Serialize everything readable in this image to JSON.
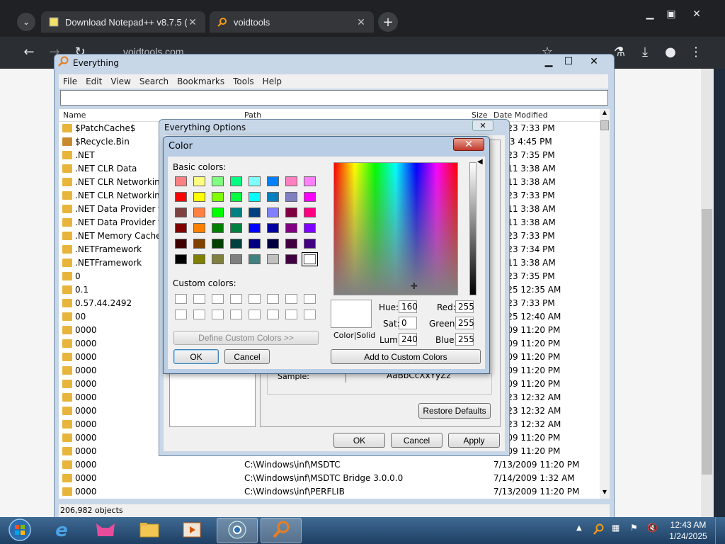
{
  "browser": {
    "tabs": [
      {
        "label": "Download Notepad++ v8.7.5 (",
        "active": false
      },
      {
        "label": "voidtools",
        "active": true
      }
    ],
    "address": "voidtools.com"
  },
  "everything": {
    "title": "Everything",
    "menu": [
      "File",
      "Edit",
      "View",
      "Search",
      "Bookmarks",
      "Tools",
      "Help"
    ],
    "columns": {
      "name": "Name",
      "path": "Path",
      "size": "Size",
      "date": "Date Modified"
    },
    "rows": [
      {
        "name": "$PatchCache$",
        "path": "",
        "date": "/2023 7:33 PM",
        "lock": false
      },
      {
        "name": "$Recycle.Bin",
        "path": "",
        "date": "2023 4:45 PM",
        "lock": true
      },
      {
        "name": ".NET",
        "path": "",
        "date": "/2023 7:35 PM",
        "lock": false
      },
      {
        "name": ".NET CLR Data",
        "path": "",
        "date": "/2011 3:38 AM",
        "lock": false
      },
      {
        "name": ".NET CLR Networking",
        "path": "",
        "date": "/2011 3:38 AM",
        "lock": false
      },
      {
        "name": ".NET CLR Networking 4",
        "path": "",
        "date": "/2023 7:33 PM",
        "lock": false
      },
      {
        "name": ".NET Data Provider for",
        "path": "",
        "date": "/2011 3:38 AM",
        "lock": false
      },
      {
        "name": ".NET Data Provider for",
        "path": "",
        "date": "/2011 3:38 AM",
        "lock": false
      },
      {
        "name": ".NET Memory Cache 4",
        "path": "",
        "date": "/2023 7:33 PM",
        "lock": false
      },
      {
        "name": ".NETFramework",
        "path": "",
        "date": "/2023 7:34 PM",
        "lock": false
      },
      {
        "name": ".NETFramework",
        "path": "",
        "date": "/2011 3:38 AM",
        "lock": false
      },
      {
        "name": "0",
        "path": "",
        "date": "/2023 7:35 PM",
        "lock": false
      },
      {
        "name": "0.1",
        "path": "",
        "date": "/2025 12:35 AM",
        "lock": false
      },
      {
        "name": "0.57.44.2492",
        "path": "",
        "date": "/2023 7:33 PM",
        "lock": false
      },
      {
        "name": "00",
        "path": "",
        "date": "/2025 12:40 AM",
        "lock": false
      },
      {
        "name": "0000",
        "path": "",
        "date": "/2009 11:20 PM",
        "lock": false
      },
      {
        "name": "0000",
        "path": "",
        "date": "/2009 11:20 PM",
        "lock": false
      },
      {
        "name": "0000",
        "path": "",
        "date": "/2009 11:20 PM",
        "lock": false
      },
      {
        "name": "0000",
        "path": "",
        "date": "/2009 11:20 PM",
        "lock": false
      },
      {
        "name": "0000",
        "path": "",
        "date": "/2009 11:20 PM",
        "lock": false
      },
      {
        "name": "0000",
        "path": "",
        "date": "/2023 12:32 AM",
        "lock": false
      },
      {
        "name": "0000",
        "path": "",
        "date": "/2023 12:32 AM",
        "lock": false
      },
      {
        "name": "0000",
        "path": "",
        "date": "/2023 12:32 AM",
        "lock": false
      },
      {
        "name": "0000",
        "path": "",
        "date": "/2009 11:20 PM",
        "lock": false
      },
      {
        "name": "0000",
        "path": "",
        "date": "/2009 11:20 PM",
        "lock": false
      },
      {
        "name": "0000",
        "path": "C:\\Windows\\inf\\MSDTC",
        "date": "7/13/2009 11:20 PM",
        "lock": false
      },
      {
        "name": "0000",
        "path": "C:\\Windows\\inf\\MSDTC Bridge 3.0.0.0",
        "date": "7/14/2009 1:32 AM",
        "lock": false
      },
      {
        "name": "0000",
        "path": "C:\\Windows\\inf\\PERFLIB",
        "date": "7/13/2009 11:20 PM",
        "lock": false
      }
    ],
    "status": "206,982 objects"
  },
  "options": {
    "title": "Everything Options",
    "sample_label": "Sample:",
    "sample_text": "AaBbCcXxYyZz",
    "restore_defaults": "Restore Defaults",
    "ok": "OK",
    "cancel": "Cancel",
    "apply": "Apply"
  },
  "color": {
    "title": "Color",
    "basic_colors_label": "Basic colors:",
    "custom_colors_label": "Custom colors:",
    "define_custom": "Define Custom Colors >>",
    "ok": "OK",
    "cancel": "Cancel",
    "add_custom": "Add to Custom Colors",
    "color_solid": "Color|Solid",
    "hue_label": "Hue:",
    "hue": "160",
    "sat_label": "Sat:",
    "sat": "0",
    "lum_label": "Lum:",
    "lum": "240",
    "red_label": "Red:",
    "red": "255",
    "green_label": "Green:",
    "green": "255",
    "blue_label": "Blue:",
    "blue": "255",
    "basic_colors": [
      "#ff8080",
      "#ffff80",
      "#80ff80",
      "#00ff80",
      "#80ffff",
      "#0080ff",
      "#ff80c0",
      "#ff80ff",
      "#ff0000",
      "#ffff00",
      "#80ff00",
      "#00ff40",
      "#00ffff",
      "#0080c0",
      "#8080c0",
      "#ff00ff",
      "#804040",
      "#ff8040",
      "#00ff00",
      "#008080",
      "#004080",
      "#8080ff",
      "#800040",
      "#ff0080",
      "#800000",
      "#ff8000",
      "#008000",
      "#008040",
      "#0000ff",
      "#0000a0",
      "#800080",
      "#8000ff",
      "#400000",
      "#804000",
      "#004000",
      "#004040",
      "#000080",
      "#000040",
      "#400040",
      "#400080",
      "#000000",
      "#808000",
      "#808040",
      "#808080",
      "#408080",
      "#c0c0c0",
      "#400040",
      "#ffffff"
    ]
  },
  "taskbar": {
    "time": "12:43 AM",
    "date": "1/24/2025"
  }
}
